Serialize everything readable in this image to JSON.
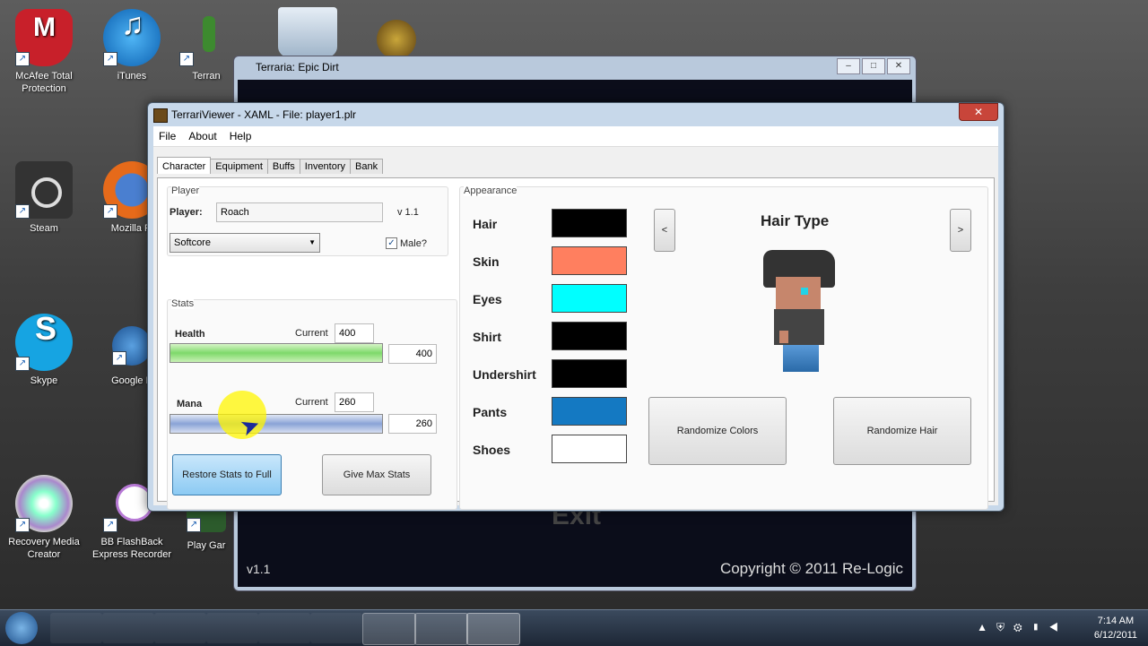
{
  "desktop": {
    "icons": [
      {
        "label_line1": "McAfee Total",
        "label_line2": "Protection",
        "icon": "mcafee-icon"
      },
      {
        "label_line1": "iTunes",
        "label_line2": "",
        "icon": "itunes-icon"
      },
      {
        "label_line1": "Terran",
        "label_line2": "",
        "icon": "terraria-icon"
      },
      {
        "label_line1": "Steam",
        "label_line2": "",
        "icon": "steam-icon"
      },
      {
        "label_line1": "Mozilla Fi",
        "label_line2": "",
        "icon": "firefox-icon"
      },
      {
        "label_line1": "Skype",
        "label_line2": "",
        "icon": "skype-icon"
      },
      {
        "label_line1": "Google E",
        "label_line2": "",
        "icon": "google-earth-icon"
      },
      {
        "label_line1": "Recovery Media",
        "label_line2": "Creator",
        "icon": "recovery-media-icon"
      },
      {
        "label_line1": "BB FlashBack",
        "label_line2": "Express Recorder",
        "icon": "bb-flashback-icon"
      },
      {
        "label_line1": "Play Gar",
        "label_line2": "",
        "icon": "play-games-icon"
      }
    ]
  },
  "bg_window": {
    "title": "Terraria: Epic Dirt",
    "version": "v1.1",
    "copyright": "Copyright © 2011 Re-Logic",
    "exit_text": "Exit"
  },
  "app": {
    "title": "TerrariViewer - XAML - File: player1.plr",
    "close_glyph": "✕",
    "menu": [
      "File",
      "About",
      "Help"
    ],
    "tabs": [
      "Character",
      "Equipment",
      "Buffs",
      "Inventory",
      "Bank"
    ],
    "player_group": {
      "title": "Player",
      "player_label": "Player:",
      "player_name": "Roach",
      "version": "v 1.1",
      "difficulty": "Softcore",
      "male_label": "Male?",
      "male_checked": true
    },
    "stats_group": {
      "title": "Stats",
      "health_label": "Health",
      "health_current_label": "Current",
      "health_current": "400",
      "health_max": "400",
      "health_fill": 1.0,
      "mana_label": "Mana",
      "mana_current_label": "Current",
      "mana_current": "260",
      "mana_max": "260",
      "mana_fill": 1.0,
      "restore_button": "Restore Stats to Full",
      "max_button": "Give Max Stats"
    },
    "appearance_group": {
      "title": "Appearance",
      "colors": [
        {
          "label": "Hair",
          "color": "#000000"
        },
        {
          "label": "Skin",
          "color": "#ff7f5f"
        },
        {
          "label": "Eyes",
          "color": "#00ffff"
        },
        {
          "label": "Shirt",
          "color": "#000000"
        },
        {
          "label": "Undershirt",
          "color": "#000000"
        },
        {
          "label": "Pants",
          "color": "#1479c2"
        },
        {
          "label": "Shoes",
          "color": "#ffffff"
        }
      ],
      "hair_type_label": "Hair Type",
      "prev_button": "<",
      "next_button": ">",
      "randomize_colors": "Randomize Colors",
      "randomize_hair": "Randomize Hair"
    }
  },
  "taskbar": {
    "time": "7:14 AM",
    "date": "6/12/2011"
  }
}
